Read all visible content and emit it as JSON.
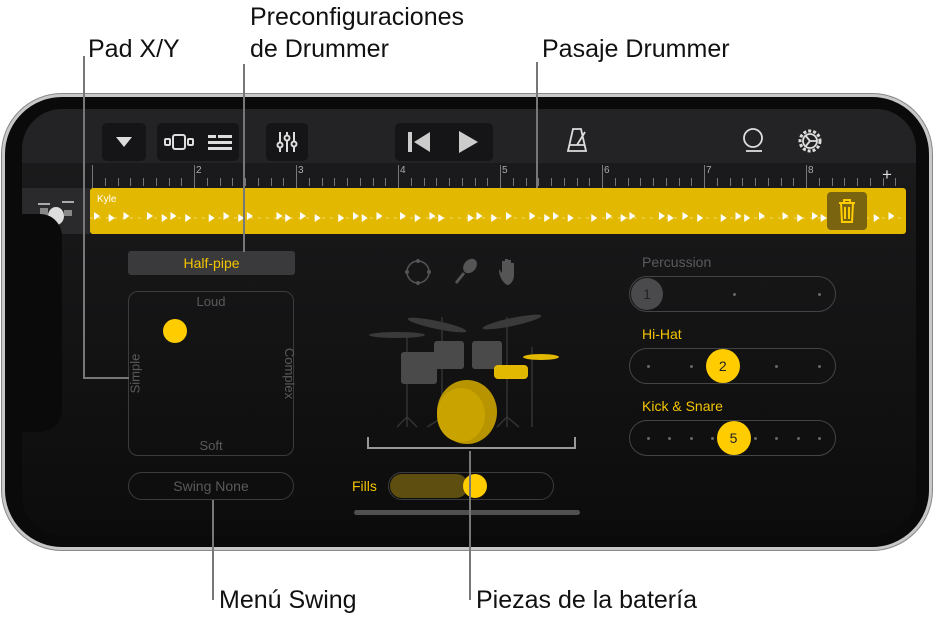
{
  "annotations": {
    "pad_xy": "Pad X/Y",
    "presets_line1": "Preconfiguraciones",
    "presets_line2": "de Drummer",
    "drummer_region": "Pasaje Drummer",
    "swing_menu": "Menú Swing",
    "kit_pieces": "Piezas de la batería"
  },
  "toolbar": {
    "icons": [
      "browser-triangle-icon",
      "instrument-view-icon",
      "tracks-view-icon",
      "mixer-icon",
      "rewind-icon",
      "play-icon",
      "metronome-icon",
      "loop-icon",
      "settings-gear-icon"
    ]
  },
  "ruler": {
    "bars": [
      "2",
      "3",
      "4",
      "5",
      "6",
      "7",
      "8"
    ],
    "add": "+"
  },
  "track": {
    "name": "Kyle",
    "delete_icon": "trash-icon"
  },
  "preset": {
    "label": "Half-pipe"
  },
  "xy_pad": {
    "top": "Loud",
    "bottom": "Soft",
    "left": "Simple",
    "right": "Complex",
    "puck_x": 0.28,
    "puck_y": 0.24
  },
  "swing": {
    "label": "Swing None"
  },
  "fills": {
    "label": "Fills",
    "value": 0.4
  },
  "kit": {
    "icons": [
      "tambourine-icon",
      "shaker-icon",
      "hand-clap-icon"
    ]
  },
  "sliders": [
    {
      "label": "Percussion",
      "value": "1",
      "active": false,
      "positions": 3,
      "index": 0
    },
    {
      "label": "Hi-Hat",
      "value": "2",
      "active": true,
      "positions": 5,
      "index": 1.75
    },
    {
      "label": "Kick & Snare",
      "value": "5",
      "active": true,
      "positions": 9,
      "index": 4
    }
  ],
  "colors": {
    "accent": "#ffcc00",
    "region": "#e3b800",
    "inactive": "#5a5a5c"
  }
}
